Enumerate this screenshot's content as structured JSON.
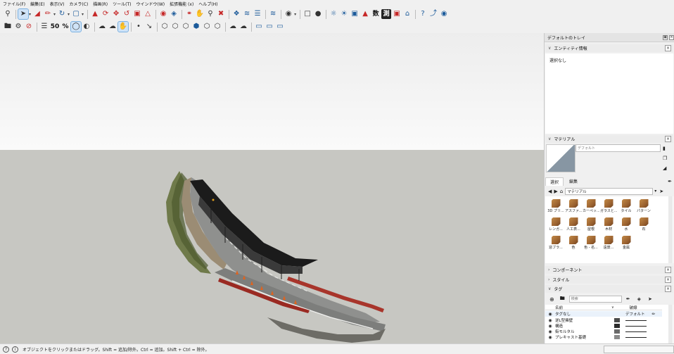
{
  "menu": [
    "ファイル(F)",
    "編集(E)",
    "表示(V)",
    "カメラ(C)",
    "描画(R)",
    "ツール(T)",
    "ウインドウ(W)",
    "拡張機能 (x)",
    "ヘルプ(H)"
  ],
  "toolbar1_text": {
    "suu": "数",
    "soku": "測"
  },
  "tray": {
    "title": "デフォルトのトレイ",
    "entity_info": {
      "title": "エンティティ情報",
      "status": "選択なし"
    },
    "materials": {
      "title": "マテリアル",
      "name_value": "デフォルト",
      "tabs": [
        "選択",
        "編集"
      ],
      "library": "マテリアル",
      "tiles": [
        "3D プリ...",
        "アスファ...",
        "カーペッ...",
        "ガラスと...",
        "タイル",
        "パターン",
        "レンガ...",
        "人工表...",
        "屋根",
        "木材",
        "水",
        "石",
        "窓ブラ...",
        "色",
        "色 - 名...",
        "遠景...",
        "金属"
      ]
    },
    "components": {
      "title": "コンポーネント"
    },
    "styles": {
      "title": "スタイル"
    },
    "tags": {
      "title": "タグ",
      "search_placeholder": "検索",
      "col_name": "名前",
      "col_dash": "破線",
      "rows": [
        {
          "name": "タグなし",
          "color": "",
          "dash": "デフォルト"
        },
        {
          "name": "逆L型擁壁",
          "color": "#4a4a4a",
          "dash": ""
        },
        {
          "name": "構造",
          "color": "#2b2b2b",
          "dash": ""
        },
        {
          "name": "街モルタル",
          "color": "#6a6a6a",
          "dash": ""
        },
        {
          "name": "プレキャスト基礎",
          "color": "#8a8a8a",
          "dash": ""
        }
      ]
    }
  },
  "status": {
    "text": "オブジェクトをクリックまたはドラッグ。Shift = 追加/除外。Ctrl = 追加。Shift + Ctrl = 除外。"
  }
}
